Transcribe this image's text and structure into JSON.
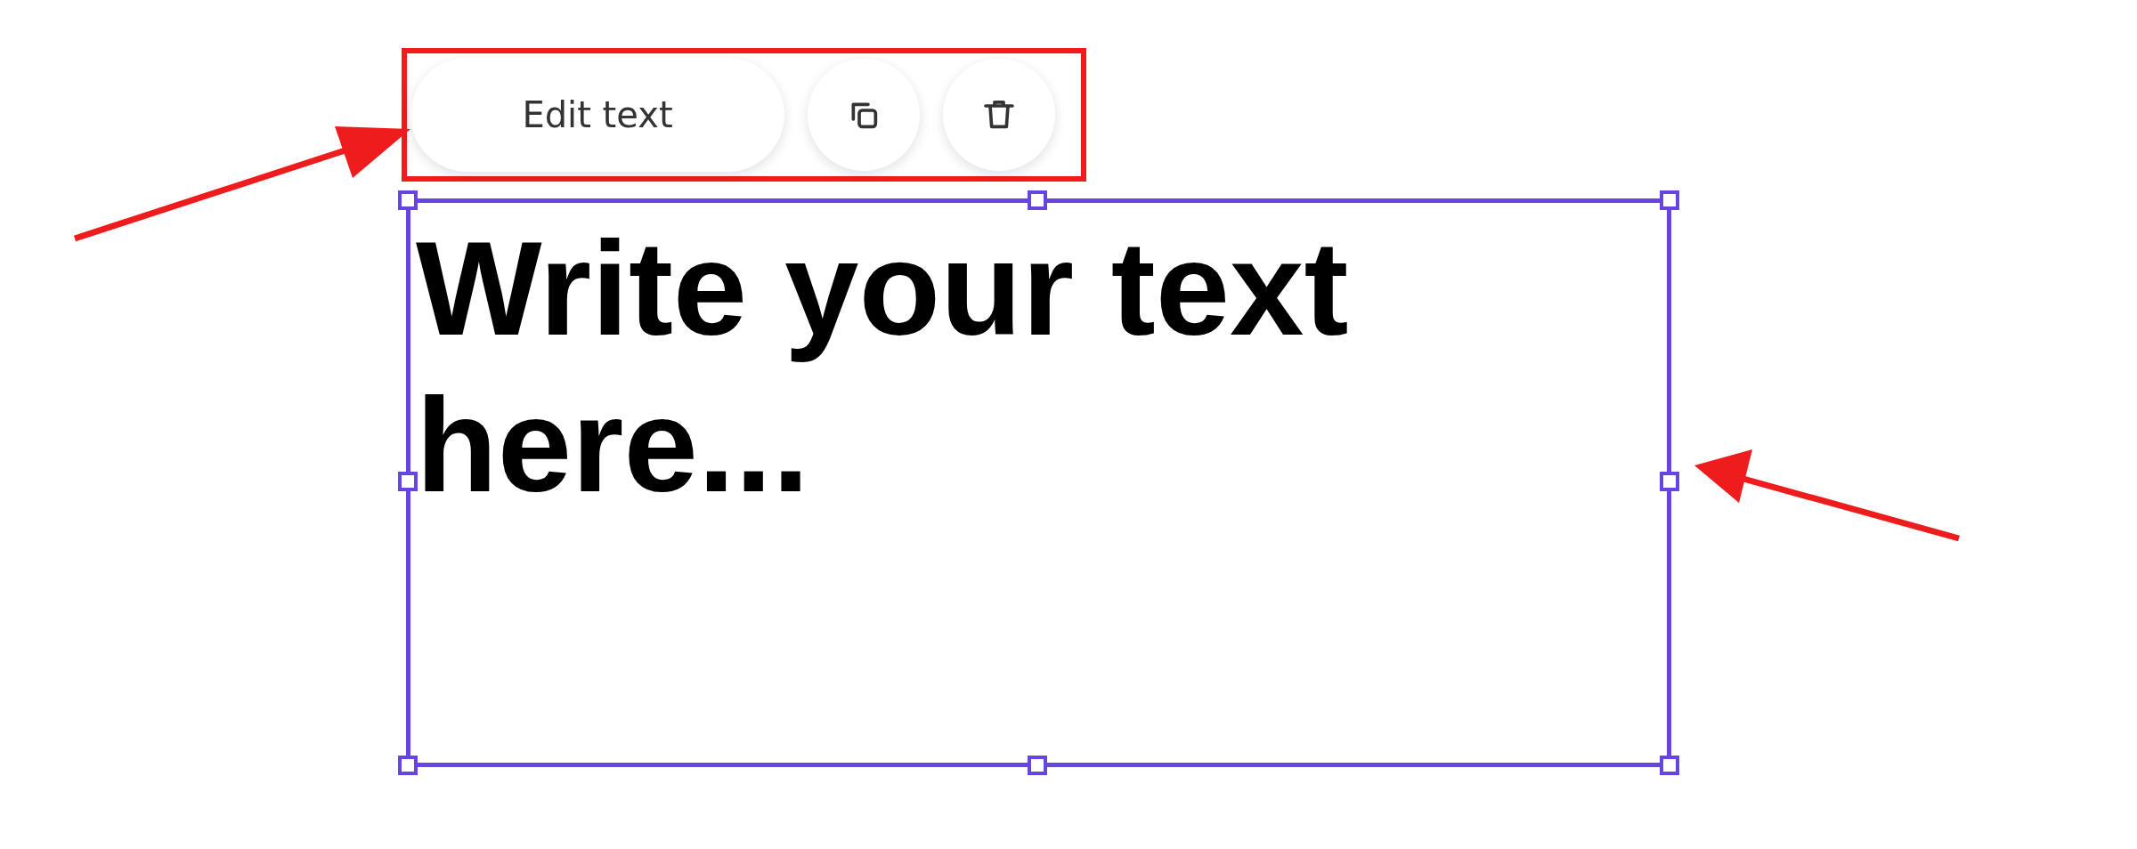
{
  "toolbar": {
    "buttons": [
      {
        "kind": "label",
        "label": "Edit text"
      },
      {
        "kind": "copy"
      },
      {
        "kind": "delete"
      }
    ]
  },
  "text_box": {
    "text": "Write your text here..."
  }
}
